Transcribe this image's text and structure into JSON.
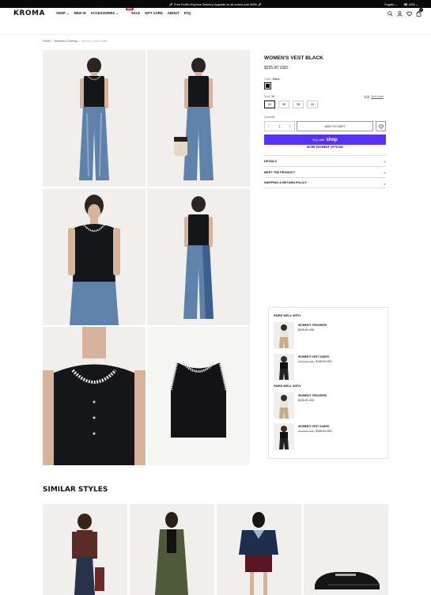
{
  "announcement": {
    "text": "🚀 Free FedEx Express Delivery Upgrade on all orders over $300 🚀",
    "language": "English",
    "currency": "USD"
  },
  "header": {
    "logo": "KROMA",
    "nav": [
      {
        "label": "SHOP"
      },
      {
        "label": "NEW IN"
      },
      {
        "label": "ACCESSORIES"
      },
      {
        "label": "SALE",
        "badge": "NEW"
      },
      {
        "label": "GIFT CARD"
      },
      {
        "label": "ABOUT"
      },
      {
        "label": "FAQ"
      }
    ],
    "cart_count": "0",
    "icons": [
      "search-icon",
      "user-icon",
      "heart-icon",
      "bag-icon"
    ]
  },
  "breadcrumb": {
    "items": [
      "Home",
      "Women's Clothing"
    ],
    "current": "Women's vest Black"
  },
  "product": {
    "title": "WOMEN'S VEST BLACK",
    "price": "$225.00 USD",
    "color_label": "Color:",
    "color_value": "Black",
    "size_label": "Size:",
    "size_value": "34",
    "size_chart": "Size chart",
    "sizes": [
      "34",
      "36",
      "38",
      "40"
    ],
    "quantity_label": "Quantity",
    "quantity": "1",
    "add_to_cart": "ADD TO CART",
    "shop_pay_prefix": "Buy with",
    "shop_pay_brand": "shop",
    "more_payment": "MORE PAYMENT OPTIONS",
    "accordions": [
      "DETAILS",
      "MEET THE PRODUCT",
      "SHIPPING & RETURN POLICY"
    ]
  },
  "pairs": {
    "heading": "PAIRS WELL WITH",
    "groups": [
      {
        "items": [
          {
            "name": "WOMEN'S TROUSERS",
            "price": "$245.00 USD",
            "compare": ""
          },
          {
            "name": "WOMEN'S VEST SADRO",
            "price": "$145.00 USD",
            "compare": "$290.00 USD"
          }
        ]
      },
      {
        "items": [
          {
            "name": "WOMEN'S TROUSERS",
            "price": "$245.00 USD",
            "compare": ""
          },
          {
            "name": "WOMEN'S VEST SADRO",
            "price": "$145.00 USD",
            "compare": "$290.00 USD"
          }
        ]
      }
    ]
  },
  "similar": {
    "heading": "SIMILAR STYLES"
  },
  "colors": {
    "accent": "#5a31f4",
    "sale_badge": "#d3122a",
    "topbar": "#0a0a0a"
  }
}
